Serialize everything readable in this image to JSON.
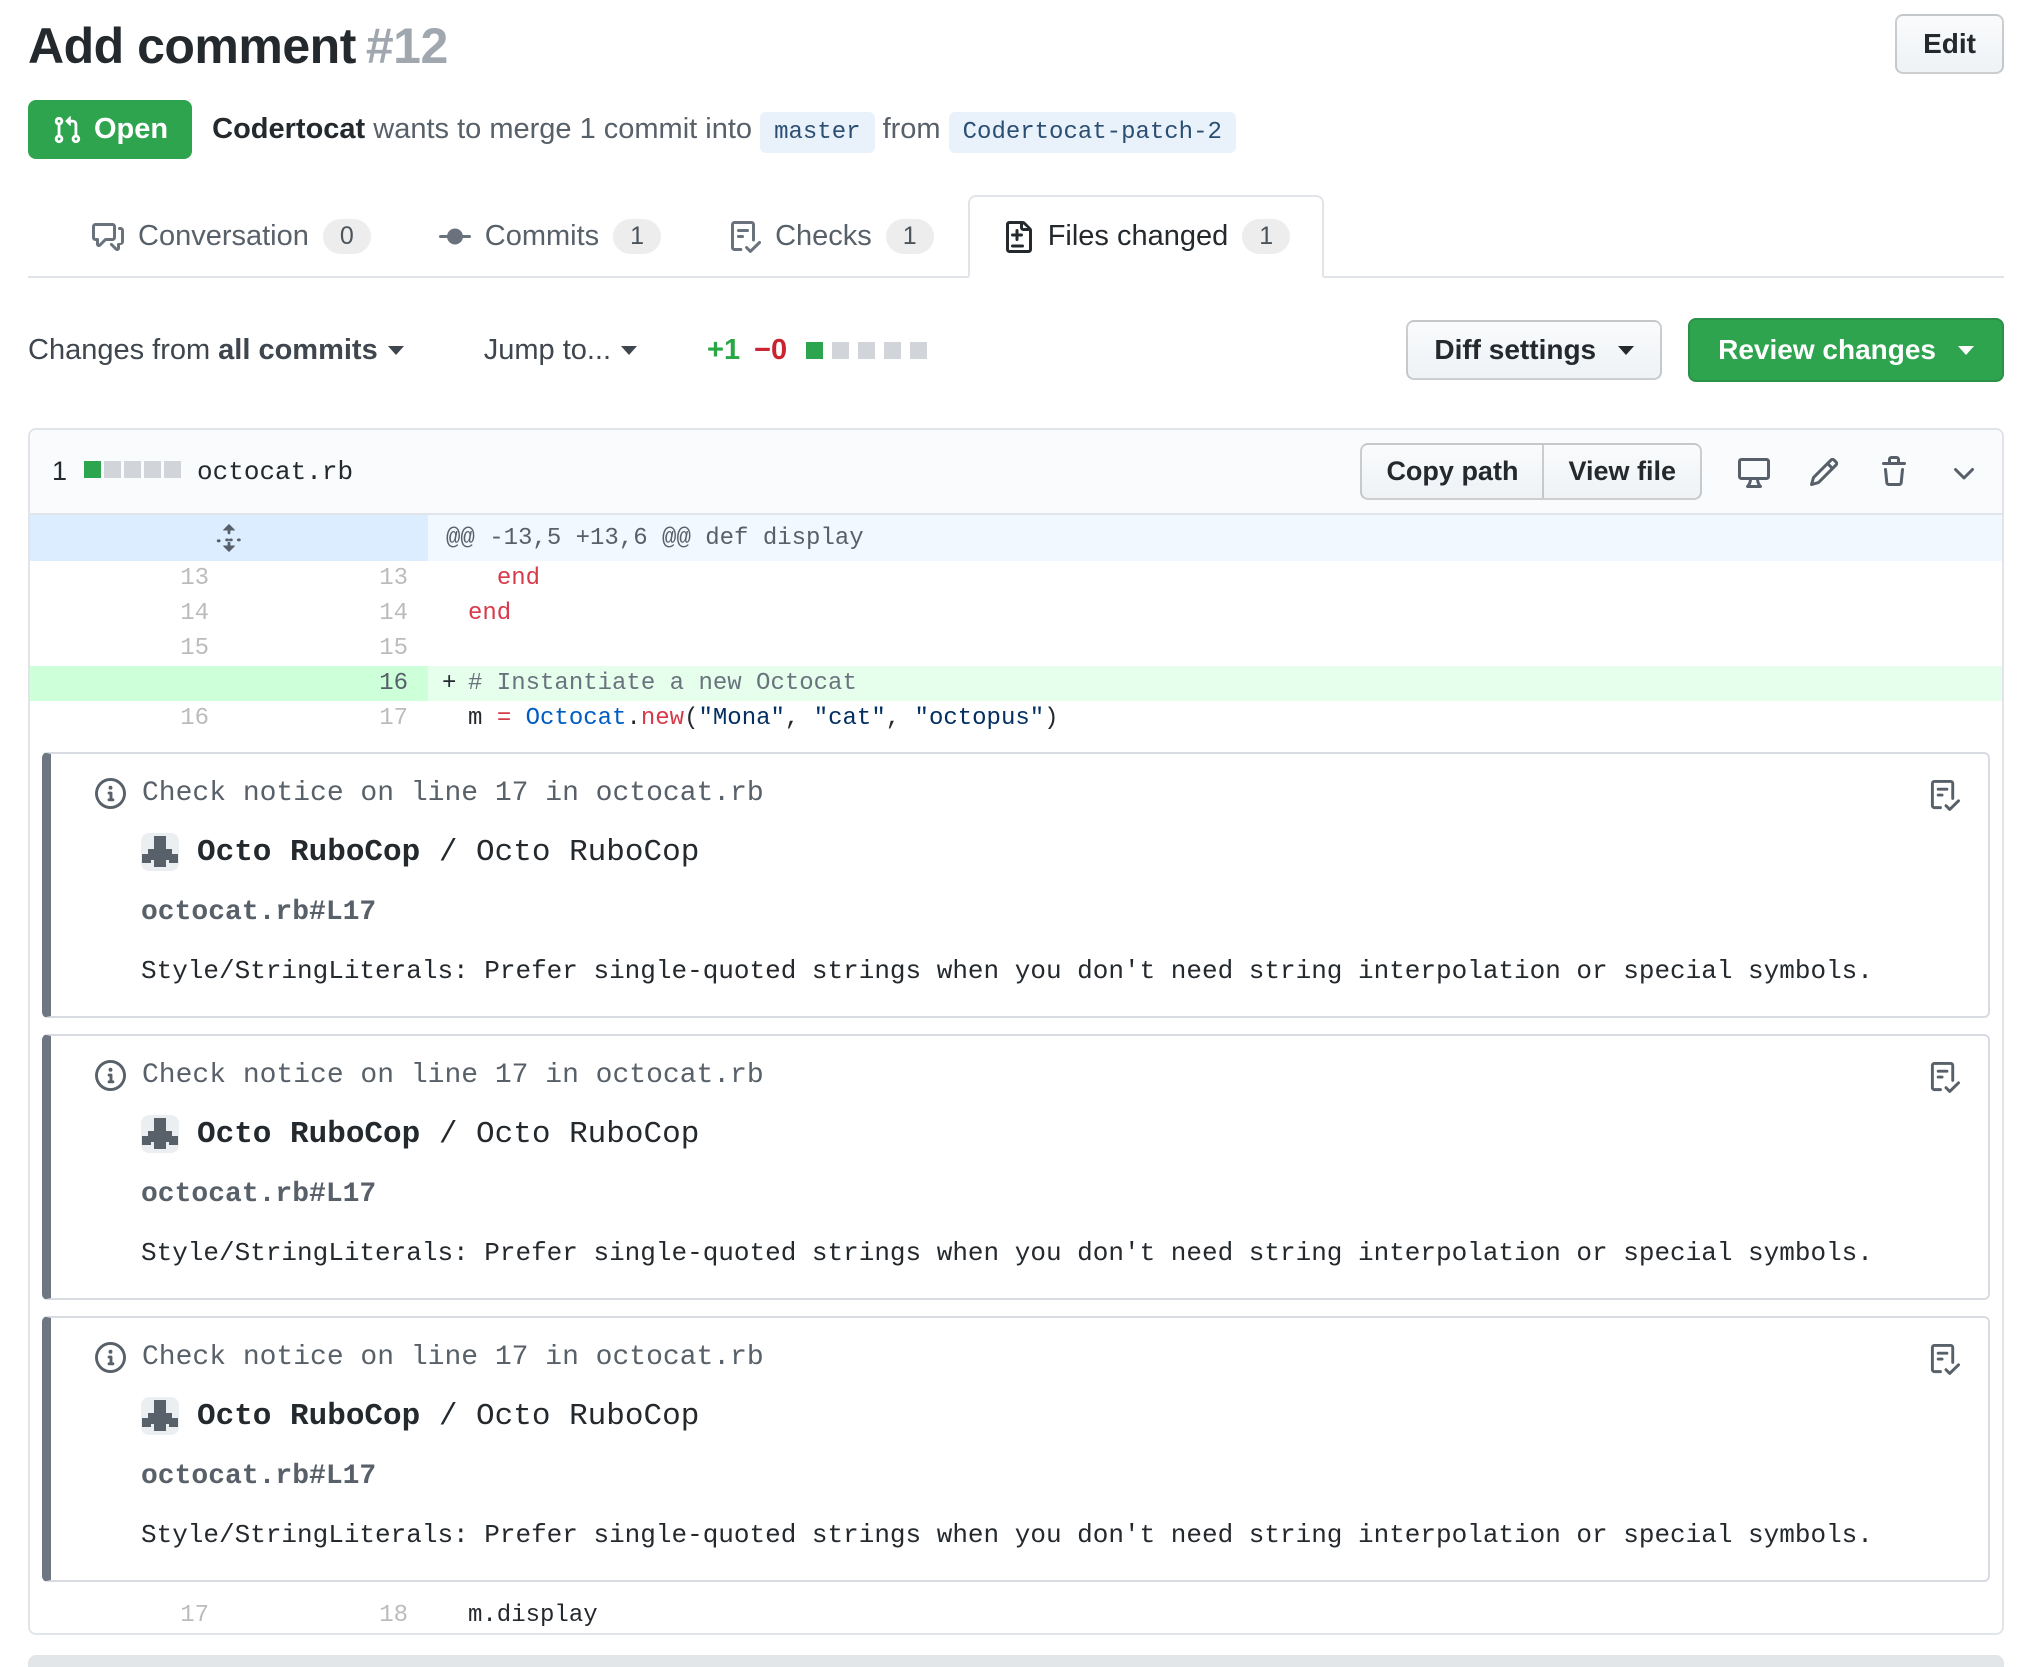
{
  "header": {
    "title": "Add comment",
    "number": "#12",
    "edit_label": "Edit",
    "state_label": "Open",
    "meta": {
      "author": "Codertocat",
      "text": "wants to merge 1 commit into",
      "base_branch": "master",
      "from_word": "from",
      "head_branch": "Codertocat-patch-2"
    }
  },
  "tabs": [
    {
      "label": "Conversation",
      "count": "0",
      "active": false
    },
    {
      "label": "Commits",
      "count": "1",
      "active": false
    },
    {
      "label": "Checks",
      "count": "1",
      "active": false
    },
    {
      "label": "Files changed",
      "count": "1",
      "active": true
    }
  ],
  "toolbar": {
    "changes_from_prefix": "Changes from",
    "changes_from_bold": "all commits",
    "jump_to": "Jump to...",
    "additions": "+1",
    "deletions": "−0",
    "diffstat": {
      "added_blocks": 1,
      "neutral_blocks": 4
    }
  },
  "buttons": {
    "diff_settings": "Diff settings",
    "review_changes": "Review changes",
    "copy_path": "Copy path",
    "view_file": "View file"
  },
  "file": {
    "changed_count": "1",
    "name": "octocat.rb",
    "diffstat": {
      "added_blocks": 1,
      "neutral_blocks": 4
    }
  },
  "diff": {
    "hunk": "@@ -13,5 +13,6 @@ def display",
    "rows_top": [
      {
        "old": "13",
        "new": "13",
        "marker": " ",
        "add": false,
        "tokens": [
          {
            "t": "  ",
            "c": "pln"
          },
          {
            "t": "end",
            "c": "kw"
          }
        ]
      },
      {
        "old": "14",
        "new": "14",
        "marker": " ",
        "add": false,
        "tokens": [
          {
            "t": "end",
            "c": "kw"
          }
        ]
      },
      {
        "old": "15",
        "new": "15",
        "marker": " ",
        "add": false,
        "tokens": []
      },
      {
        "old": "",
        "new": "16",
        "marker": "+",
        "add": true,
        "tokens": [
          {
            "t": "# Instantiate a new Octocat",
            "c": "cmt"
          }
        ]
      },
      {
        "old": "16",
        "new": "17",
        "marker": " ",
        "add": false,
        "tokens": [
          {
            "t": "m ",
            "c": "pln"
          },
          {
            "t": "=",
            "c": "kw"
          },
          {
            "t": " ",
            "c": "pln"
          },
          {
            "t": "Octocat",
            "c": "cns"
          },
          {
            "t": ".",
            "c": "pln"
          },
          {
            "t": "new",
            "c": "kw"
          },
          {
            "t": "(",
            "c": "pln"
          },
          {
            "t": "\"Mona\"",
            "c": "str"
          },
          {
            "t": ", ",
            "c": "pln"
          },
          {
            "t": "\"cat\"",
            "c": "str"
          },
          {
            "t": ", ",
            "c": "pln"
          },
          {
            "t": "\"octopus\"",
            "c": "str"
          },
          {
            "t": ")",
            "c": "pln"
          }
        ]
      }
    ],
    "rows_bottom": [
      {
        "old": "17",
        "new": "18",
        "marker": " ",
        "add": false,
        "tokens": [
          {
            "t": "m.display",
            "c": "pln"
          }
        ]
      }
    ]
  },
  "notices": [
    {
      "header": "Check notice on line 17 in octocat.rb",
      "app_name": "Octo RuboCop",
      "app_suffix": " / Octo RuboCop",
      "path": "octocat.rb#L17",
      "message": "Style/StringLiterals: Prefer single-quoted strings when you don't need string interpolation or special symbols."
    },
    {
      "header": "Check notice on line 17 in octocat.rb",
      "app_name": "Octo RuboCop",
      "app_suffix": " / Octo RuboCop",
      "path": "octocat.rb#L17",
      "message": "Style/StringLiterals: Prefer single-quoted strings when you don't need string interpolation or special symbols."
    },
    {
      "header": "Check notice on line 17 in octocat.rb",
      "app_name": "Octo RuboCop",
      "app_suffix": " / Octo RuboCop",
      "path": "octocat.rb#L17",
      "message": "Style/StringLiterals: Prefer single-quoted strings when you don't need string interpolation or special symbols."
    }
  ],
  "icons": {
    "open-badge": "git-pull-request-icon",
    "tab_icons": [
      "comment-discussion-icon",
      "git-commit-icon",
      "checklist-icon",
      "file-diff-icon"
    ],
    "file_header_icons": [
      "display-rich-diff-icon",
      "edit-file-icon",
      "delete-file-icon",
      "chevron-down-icon"
    ],
    "hunk": "unfold-icon",
    "notice": [
      "info-icon",
      "checklist-icon"
    ]
  },
  "colors": {
    "accent_green": "#2ea44f",
    "addition_green": "#28a745",
    "deletion_red": "#cb2431",
    "added_line_bg": "#e6ffed",
    "added_num_bg": "#cdffd8",
    "hunk_num_bg": "#dbedff",
    "hunk_bg": "#f1f8ff",
    "branch_chip_bg": "#e9f2fb",
    "notice_bar": "#6e7781",
    "keyword": "#d73a49",
    "constant": "#005cc5",
    "string": "#032f62",
    "comment": "#6a737d"
  }
}
